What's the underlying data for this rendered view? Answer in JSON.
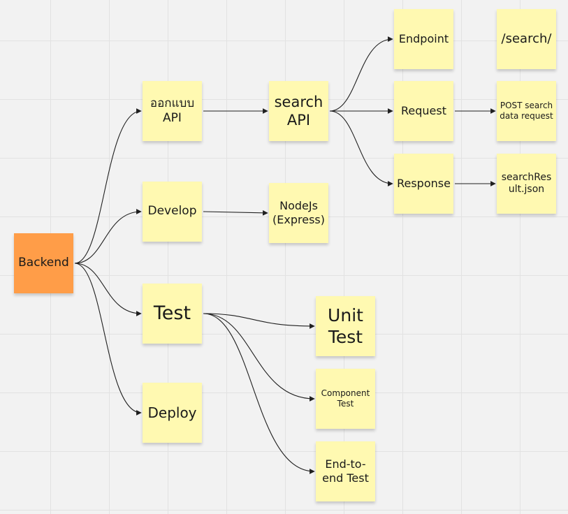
{
  "notes": {
    "backend": {
      "text": "Backend",
      "color": "#ff9d48"
    },
    "design": {
      "text": "ออกแบบ API",
      "color": "#fff9b1"
    },
    "develop": {
      "text": "Develop",
      "color": "#fff9b1"
    },
    "test": {
      "text": "Test",
      "color": "#fff9b1"
    },
    "deploy": {
      "text": "Deploy",
      "color": "#fff9b1"
    },
    "search": {
      "text": "search API",
      "color": "#fff9b1"
    },
    "nodejs": {
      "text": "NodeJs (Express)",
      "color": "#fff9b1"
    },
    "endpoint": {
      "text": "Endpoint",
      "color": "#fff9b1"
    },
    "request": {
      "text": "Request",
      "color": "#fff9b1"
    },
    "response": {
      "text": "Response",
      "color": "#fff9b1"
    },
    "path": {
      "text": "/search/",
      "color": "#fff9b1"
    },
    "post": {
      "text": "POST search data request",
      "color": "#fff9b1"
    },
    "result": {
      "text": "searchResult.json",
      "color": "#fff9b1"
    },
    "unit": {
      "text": "Unit Test",
      "color": "#fff9b1"
    },
    "component": {
      "text": "Component Test",
      "color": "#fff9b1"
    },
    "e2e": {
      "text": "End-to-end Test",
      "color": "#fff9b1"
    }
  },
  "edges": [
    {
      "from": "backend",
      "to": "design",
      "style": "curve"
    },
    {
      "from": "backend",
      "to": "develop",
      "style": "curve"
    },
    {
      "from": "backend",
      "to": "test",
      "style": "curve"
    },
    {
      "from": "backend",
      "to": "deploy",
      "style": "curve"
    },
    {
      "from": "design",
      "to": "search",
      "style": "straight"
    },
    {
      "from": "develop",
      "to": "nodejs",
      "style": "straight"
    },
    {
      "from": "search",
      "to": "endpoint",
      "style": "curve"
    },
    {
      "from": "search",
      "to": "request",
      "style": "curve"
    },
    {
      "from": "search",
      "to": "response",
      "style": "curve"
    },
    {
      "from": "request",
      "to": "post",
      "style": "straight"
    },
    {
      "from": "response",
      "to": "result",
      "style": "straight"
    },
    {
      "from": "test",
      "to": "unit",
      "style": "curve"
    },
    {
      "from": "test",
      "to": "component",
      "style": "curve"
    },
    {
      "from": "test",
      "to": "e2e",
      "style": "curve"
    }
  ],
  "colors": {
    "connector": "#1f1f1f",
    "canvas": "#f2f2f2",
    "sticky": "#fff9b1",
    "sticky_orange": "#ff9d48"
  }
}
